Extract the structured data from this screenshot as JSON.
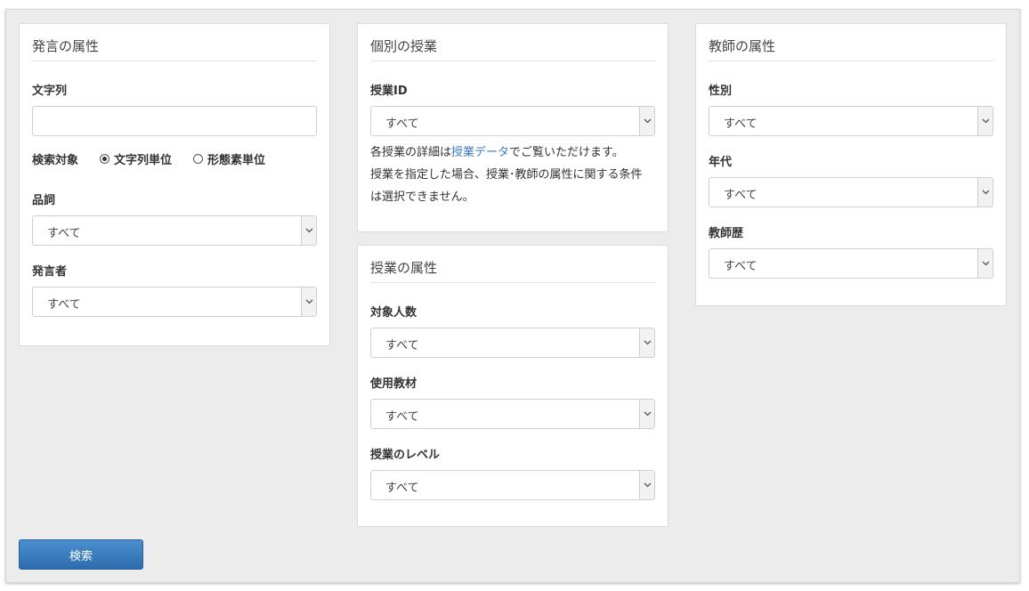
{
  "utterance_panel": {
    "title": "発言の属性",
    "string_label": "文字列",
    "string_value": "",
    "search_target_label": "検索対象",
    "search_target_options": [
      "文字列単位",
      "形態素単位"
    ],
    "search_target_selected": "文字列単位",
    "pos_label": "品詞",
    "pos_value": "すべて",
    "speaker_label": "発言者",
    "speaker_value": "すべて"
  },
  "lesson_panel": {
    "title": "個別の授業",
    "lesson_id_label": "授業ID",
    "lesson_id_value": "すべて",
    "help_prefix": "各授業の詳細は",
    "help_link": "授業データ",
    "help_suffix": "でご覧いただけます。",
    "help_line2": "授業を指定した場合、授業･教師の属性に関する条件",
    "help_line3": "は選択できません。"
  },
  "lesson_attr_panel": {
    "title": "授業の属性",
    "class_size_label": "対象人数",
    "class_size_value": "すべて",
    "material_label": "使用教材",
    "material_value": "すべて",
    "level_label": "授業のレベル",
    "level_value": "すべて"
  },
  "teacher_panel": {
    "title": "教師の属性",
    "gender_label": "性別",
    "gender_value": "すべて",
    "age_label": "年代",
    "age_value": "すべて",
    "experience_label": "教師歴",
    "experience_value": "すべて"
  },
  "search_button_label": "検索",
  "colors": {
    "background": "#ececec",
    "panel": "#ffffff",
    "link": "#3b7bbf",
    "button": "#2d6cad"
  },
  "icons": {
    "select_arrow": "chevron-down-icon",
    "radio": "radio-icon"
  }
}
